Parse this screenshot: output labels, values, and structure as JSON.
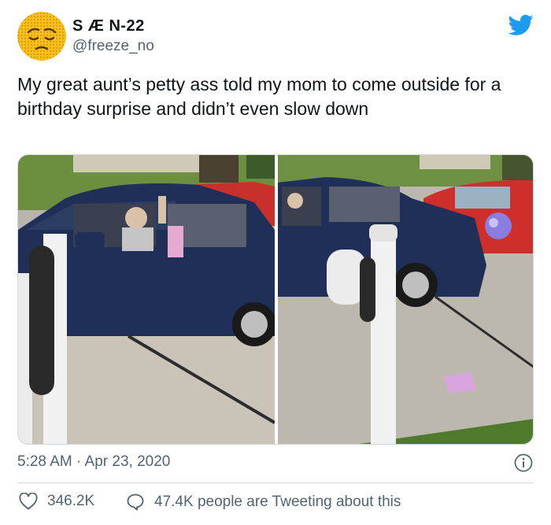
{
  "author": {
    "display_name": "S Æ N-22",
    "handle": "@freeze_no",
    "avatar_icon": "pensive-face-emoji-icon"
  },
  "brand": {
    "icon": "twitter-bird-icon",
    "color": "#1d9bf0"
  },
  "tweet": {
    "text": "My great aunt’s petty ass told my mom to come outside for a birthday surprise and didn’t even slow down",
    "timestamp": "5:28 AM · Apr 23, 2020",
    "media_count": 2
  },
  "stats": {
    "likes_icon": "heart-icon",
    "likes": "346.2K",
    "reply_icon": "speech-bubble-icon",
    "tweeting_count": "47.4K",
    "tweeting_label": "people are Tweeting about this"
  },
  "info_icon": "info-icon",
  "colors": {
    "text": "#0f1419",
    "secondary": "#536471",
    "border": "#cfd9de"
  }
}
